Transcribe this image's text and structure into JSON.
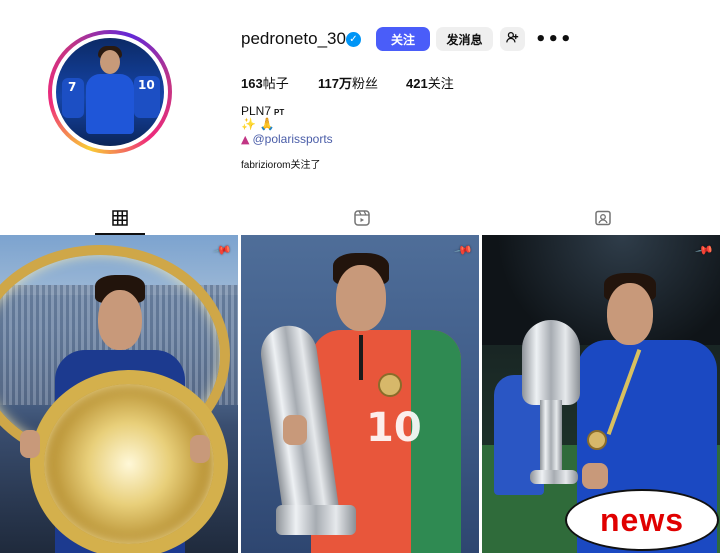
{
  "profile": {
    "username": "pedroneto_30",
    "verified_icon": "verified-badge-icon",
    "actions": {
      "follow_label": "关注",
      "message_label": "发消息",
      "add_user_icon": "add-user-icon",
      "more_icon": "more-icon"
    },
    "stats": {
      "posts_count": "163",
      "posts_label": "帖子",
      "followers_count": "117万",
      "followers_label": "粉丝",
      "following_count": "421",
      "following_label": "关注"
    },
    "bio": {
      "name": "PLN7",
      "tag": "PT",
      "emoji_line": "✨ 🙏",
      "link_text": "@polarissports"
    },
    "followed_by": "fabriziorom关注了"
  },
  "tabs": [
    {
      "name": "posts",
      "icon": "grid-icon",
      "active": true
    },
    {
      "name": "reels",
      "icon": "reels-icon",
      "active": false
    },
    {
      "name": "tagged",
      "icon": "tagged-icon",
      "active": false
    }
  ],
  "grid": {
    "pinned_icon": "pin-icon",
    "tiles": [
      {
        "jersey_number": ""
      },
      {
        "jersey_number": "10"
      },
      {
        "jersey_number": ""
      }
    ]
  },
  "colors": {
    "follow_button": "#4a5df9",
    "link": "#00376b",
    "verified": "#0095f6",
    "news_text": "#e00000"
  },
  "overlay": {
    "news_label": "news"
  }
}
